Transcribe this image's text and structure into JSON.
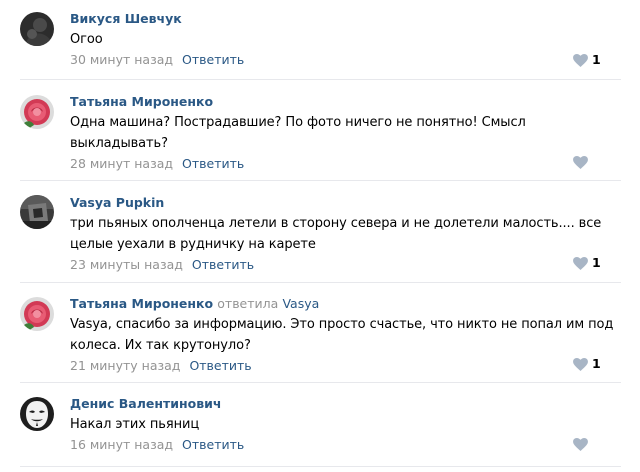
{
  "comments": [
    {
      "author": "Викуся Шевчук",
      "text": "Огоо",
      "time": "30 минут назад",
      "reply_label": "Ответить",
      "likes": "1"
    },
    {
      "author": "Татьяна Мироненко",
      "text": "Одна машина? Пострадавшие? По фото ничего не понятно! Смысл выкладывать?",
      "time": "28 минут назад",
      "reply_label": "Ответить",
      "likes": ""
    },
    {
      "author": "Vasya Pupkin",
      "text": "три пьяных ополченца летели в сторону севера и не долетели малость.... все целые уехали в рудничку на карете",
      "time": "23 минуты назад",
      "reply_label": "Ответить",
      "likes": "1"
    },
    {
      "author": "Татьяна Мироненко",
      "reply_to_prefix": "ответила",
      "reply_to_name": "Vasya",
      "text": "Vasya, спасибо за информацию. Это просто счастье, что никто не попал им под колеса. Их так крутонуло?",
      "time": "21 минуту назад",
      "reply_label": "Ответить",
      "likes": "1"
    },
    {
      "author": "Денис Валентинович",
      "text": "Накал этих пьяниц",
      "time": "16 минут назад",
      "reply_label": "Ответить",
      "likes": ""
    }
  ],
  "colors": {
    "link": "#2a5885",
    "muted": "#939393",
    "like_icon": "#a8b5c5",
    "separator": "#e7e8ec"
  },
  "icons": {
    "like": "heart-icon"
  }
}
